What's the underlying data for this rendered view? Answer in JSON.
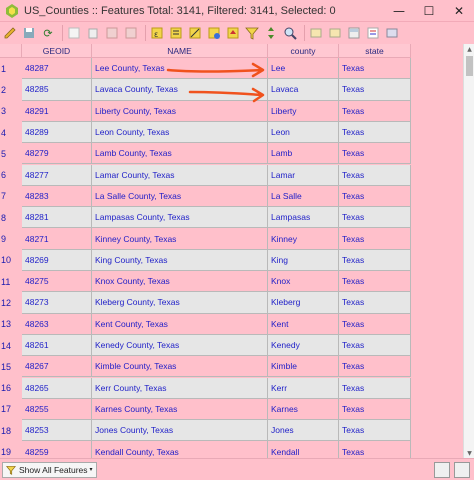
{
  "window": {
    "title": "US_Counties :: Features Total: 3141, Filtered: 3141, Selected: 0",
    "controls": [
      "minimize",
      "maximize",
      "close"
    ]
  },
  "toolbar": {
    "icons": [
      "pencil-icon",
      "save-icon",
      "reload-icon",
      "add-feature-icon",
      "delete-icon",
      "cut-icon",
      "copy-icon",
      "paste-icon",
      "select-expression-icon",
      "select-all-icon",
      "invert-selection-icon",
      "deselect-icon",
      "move-to-top-icon",
      "filter-icon",
      "pan-icon",
      "zoom-icon",
      "new-field-icon",
      "delete-field-icon",
      "field-calculator-icon",
      "conditional-format-icon",
      "dock-icon"
    ]
  },
  "table": {
    "columns": [
      "GEOID",
      "NAME",
      "county",
      "state"
    ],
    "rows": [
      {
        "num": "1",
        "geoid": "48287",
        "name": "Lee County, Texas",
        "county": "Lee",
        "state": "Texas"
      },
      {
        "num": "2",
        "geoid": "48285",
        "name": "Lavaca County, Texas",
        "county": "Lavaca",
        "state": "Texas"
      },
      {
        "num": "3",
        "geoid": "48291",
        "name": "Liberty County, Texas",
        "county": "Liberty",
        "state": "Texas"
      },
      {
        "num": "4",
        "geoid": "48289",
        "name": "Leon County, Texas",
        "county": "Leon",
        "state": "Texas"
      },
      {
        "num": "5",
        "geoid": "48279",
        "name": "Lamb County, Texas",
        "county": "Lamb",
        "state": "Texas"
      },
      {
        "num": "6",
        "geoid": "48277",
        "name": "Lamar County, Texas",
        "county": "Lamar",
        "state": "Texas"
      },
      {
        "num": "7",
        "geoid": "48283",
        "name": "La Salle County, Texas",
        "county": "La Salle",
        "state": "Texas"
      },
      {
        "num": "8",
        "geoid": "48281",
        "name": "Lampasas County, Texas",
        "county": "Lampasas",
        "state": "Texas"
      },
      {
        "num": "9",
        "geoid": "48271",
        "name": "Kinney County, Texas",
        "county": "Kinney",
        "state": "Texas"
      },
      {
        "num": "10",
        "geoid": "48269",
        "name": "King County, Texas",
        "county": "King",
        "state": "Texas"
      },
      {
        "num": "11",
        "geoid": "48275",
        "name": "Knox County, Texas",
        "county": "Knox",
        "state": "Texas"
      },
      {
        "num": "12",
        "geoid": "48273",
        "name": "Kleberg County, Texas",
        "county": "Kleberg",
        "state": "Texas"
      },
      {
        "num": "13",
        "geoid": "48263",
        "name": "Kent County, Texas",
        "county": "Kent",
        "state": "Texas"
      },
      {
        "num": "14",
        "geoid": "48261",
        "name": "Kenedy County, Texas",
        "county": "Kenedy",
        "state": "Texas"
      },
      {
        "num": "15",
        "geoid": "48267",
        "name": "Kimble County, Texas",
        "county": "Kimble",
        "state": "Texas"
      },
      {
        "num": "16",
        "geoid": "48265",
        "name": "Kerr County, Texas",
        "county": "Kerr",
        "state": "Texas"
      },
      {
        "num": "17",
        "geoid": "48255",
        "name": "Karnes County, Texas",
        "county": "Karnes",
        "state": "Texas"
      },
      {
        "num": "18",
        "geoid": "48253",
        "name": "Jones County, Texas",
        "county": "Jones",
        "state": "Texas"
      },
      {
        "num": "19",
        "geoid": "48259",
        "name": "Kendall County, Texas",
        "county": "Kendall",
        "state": "Texas"
      }
    ]
  },
  "colors": {
    "background": "#ffc0cb",
    "row_pink": "#ffc0cb",
    "row_gray": "#e6e6e6",
    "text_blue": "#1e1ec8",
    "arrow_orange": "#f0521d"
  },
  "bottom": {
    "show_all_label": "Show All Features"
  }
}
